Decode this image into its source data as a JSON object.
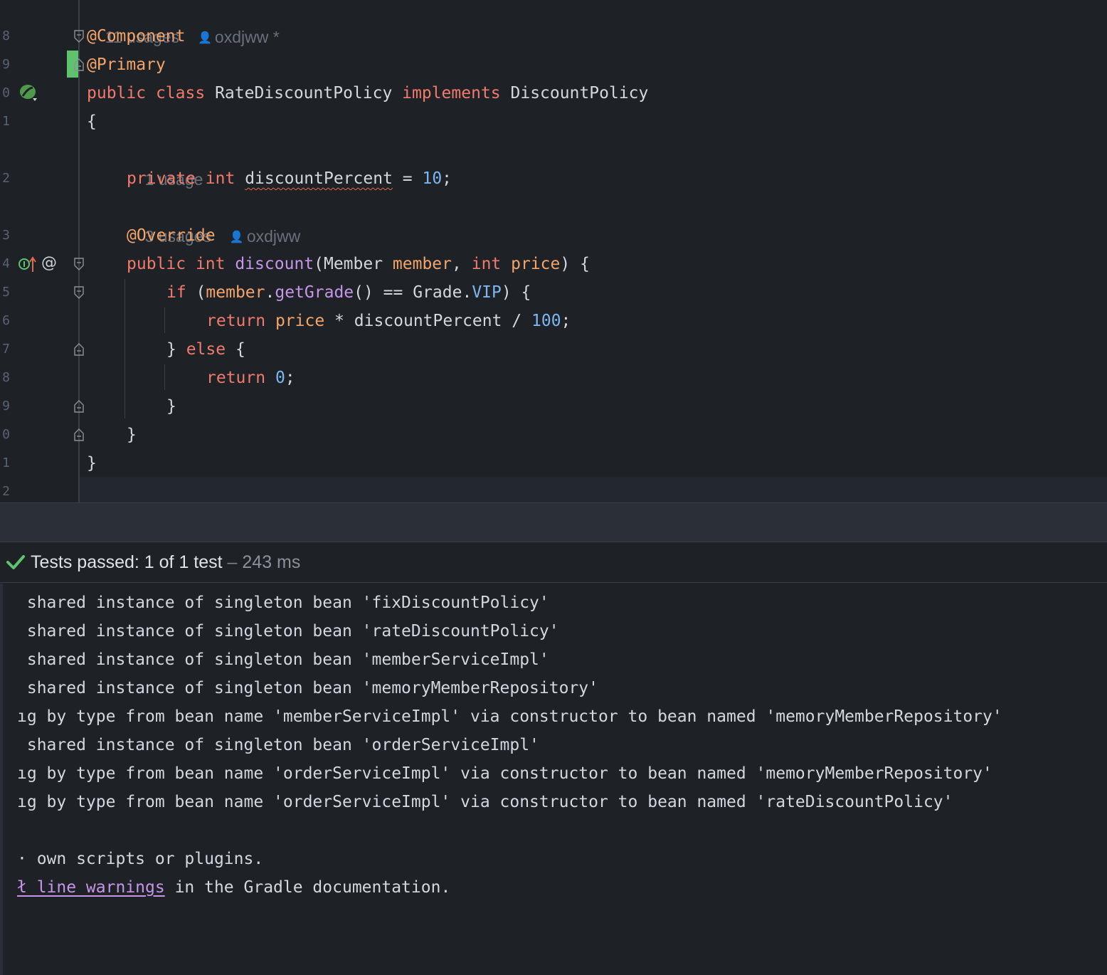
{
  "editor": {
    "line_numbers": [
      "8",
      "9",
      "0",
      "1",
      "2",
      "3",
      "4",
      "5",
      "6",
      "7",
      "8",
      "9",
      "0",
      "1",
      "2"
    ],
    "hints": {
      "class_usages": "11 usages",
      "class_author": "oxdjww *",
      "field_usages": "1 usage",
      "method_usages": "3 usages",
      "method_author": "oxdjww"
    },
    "code": {
      "l8_annotation": "@Component",
      "l9_annotation": "@Primary",
      "l10_public": "public",
      "l10_class": "class",
      "l10_name": "RateDiscountPolicy",
      "l10_implements": "implements",
      "l10_iface": "DiscountPolicy",
      "l11_brace": "{",
      "l12_private": "private",
      "l12_int": "int",
      "l12_field": "discountPercent",
      "l12_eq": " = ",
      "l12_value": "10",
      "l12_semi": ";",
      "l13_annotation": "@Override",
      "l14_public": "public",
      "l14_int": "int",
      "l14_method": "discount",
      "l14_open": "(Member ",
      "l14_param1": "member",
      "l14_comma": ", ",
      "l14_int2": "int",
      "l14_param2": "price",
      "l14_close": ") {",
      "l15_if": "if",
      "l15_open": " (",
      "l15_member": "member",
      "l15_dot": ".",
      "l15_call": "getGrade",
      "l15_mid": "() == Grade.",
      "l15_vip": "VIP",
      "l15_close": ") {",
      "l16_return": "return",
      "l16_price": "price",
      "l16_mid": " * discountPercent / ",
      "l16_value": "100",
      "l16_semi": ";",
      "l17_close": "} ",
      "l17_else": "else",
      "l17_open": " {",
      "l18_return": "return",
      "l18_value": "0",
      "l18_semi": ";",
      "l19_brace": "}",
      "l20_brace": "}",
      "l21_brace": "}"
    },
    "icons": {
      "bean": "spring-bean-icon",
      "implementing": "implementing-method-icon",
      "annotation": "@"
    }
  },
  "test_run": {
    "status_label": "Tests passed: 1 of 1 test",
    "separator": " – ",
    "duration": "243 ms"
  },
  "console": {
    "lines": [
      " shared instance of singleton bean 'fixDiscountPolicy'",
      " shared instance of singleton bean 'rateDiscountPolicy'",
      " shared instance of singleton bean 'memberServiceImpl'",
      " shared instance of singleton bean 'memoryMemberRepository'",
      "ıg by type from bean name 'memberServiceImpl' via constructor to bean named 'memoryMemberRepository'",
      " shared instance of singleton bean 'orderServiceImpl'",
      "ıg by type from bean name 'orderServiceImpl' via constructor to bean named 'memoryMemberRepository'",
      "ıg by type from bean name 'orderServiceImpl' via constructor to bean named 'rateDiscountPolicy'",
      "",
      "· own scripts or plugins."
    ],
    "last_link": "ł_line_warnings",
    "last_suffix": " in the Gradle documentation."
  },
  "colors": {
    "background": "#1e2227",
    "keyword": "#f07a6b",
    "annotation": "#f4a46a",
    "number": "#7cb7f2",
    "function": "#c695e8",
    "success": "#5ec26e"
  }
}
